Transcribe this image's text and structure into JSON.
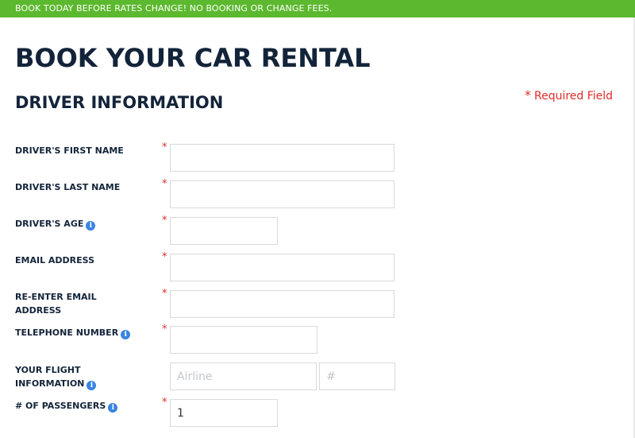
{
  "banner": {
    "text": "BOOK TODAY BEFORE RATES CHANGE! NO BOOKING OR CHANGE FEES."
  },
  "page": {
    "title": "BOOK YOUR CAR RENTAL"
  },
  "section": {
    "title": "DRIVER INFORMATION"
  },
  "required_note": {
    "star": "*",
    "text": "Required Field"
  },
  "fields": {
    "first_name": {
      "label": "DRIVER'S FIRST NAME",
      "value": ""
    },
    "last_name": {
      "label": "DRIVER'S LAST NAME",
      "value": ""
    },
    "age": {
      "label": "DRIVER'S AGE",
      "value": ""
    },
    "email": {
      "label": "EMAIL ADDRESS",
      "value": ""
    },
    "reenter_email": {
      "label": "RE-ENTER EMAIL ADDRESS",
      "value": ""
    },
    "telephone": {
      "label": "TELEPHONE NUMBER",
      "value": ""
    },
    "flight": {
      "label": "YOUR FLIGHT INFORMATION",
      "airline_placeholder": "Airline",
      "number_placeholder": "#"
    },
    "passengers": {
      "label": "# OF PASSENGERS",
      "value": "1"
    }
  },
  "icons": {
    "info": "i",
    "required": "*"
  },
  "colors": {
    "banner": "#5cb82e",
    "heading": "#13243a",
    "required": "#e02b2b",
    "info": "#3a83e0",
    "border": "#d7dadd"
  }
}
